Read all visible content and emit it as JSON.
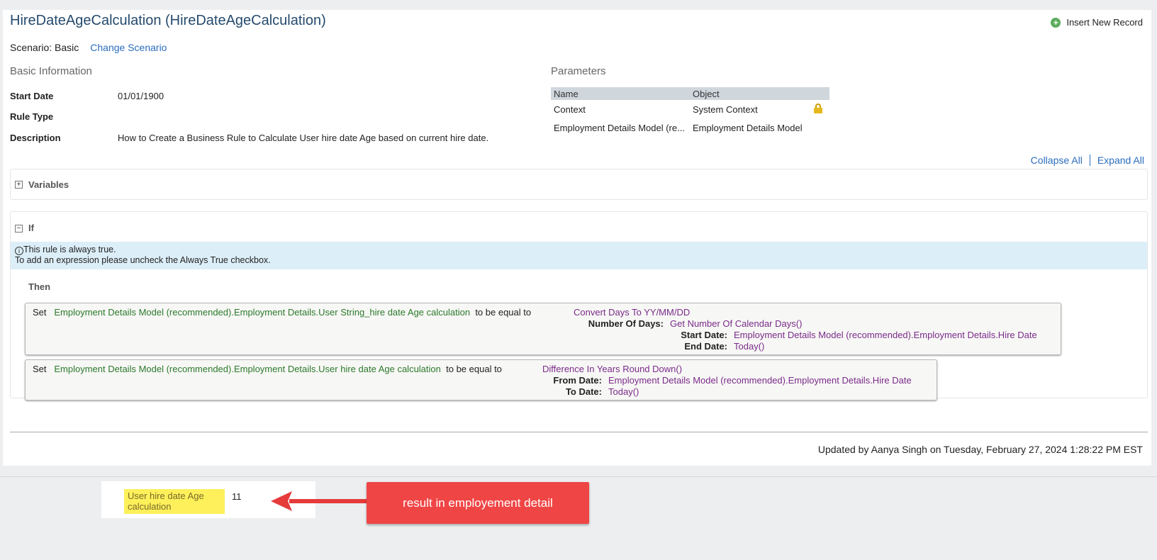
{
  "header": {
    "title": "HireDateAgeCalculation (HireDateAgeCalculation)",
    "insert_label": "Insert New Record"
  },
  "scenario": {
    "label": "Scenario: Basic",
    "change_label": "Change Scenario"
  },
  "basic_info": {
    "heading": "Basic Information",
    "rows": [
      {
        "label": "Start Date",
        "value": "01/01/1900"
      },
      {
        "label": "Rule Type",
        "value": ""
      },
      {
        "label": "Description",
        "value": "How to Create a Business Rule to Calculate User hire date Age based on current hire date."
      }
    ]
  },
  "parameters": {
    "heading": "Parameters",
    "columns": [
      "Name",
      "Object"
    ],
    "rows": [
      {
        "name": "Context",
        "object": "System Context",
        "locked": true
      },
      {
        "name": "Employment Details Model (re...",
        "object": "Employment Details Model",
        "locked": false
      }
    ]
  },
  "controls": {
    "collapse_all": "Collapse All",
    "expand_all": "Expand All"
  },
  "variables": {
    "label": "Variables",
    "toggle": "+"
  },
  "if_section": {
    "label": "If",
    "toggle": "−",
    "info_line1": "This rule is always true.",
    "info_line2": "To add an expression please uncheck the Always True checkbox.",
    "then_label": "Then"
  },
  "statements": [
    {
      "set": "Set",
      "target": "Employment Details Model (recommended).Employment Details.User String_hire date Age calculation",
      "op": "to be equal to",
      "func": "Convert Days To YY/MM/DD",
      "params": [
        {
          "label": "Number Of Days:",
          "value": "Get Number Of Calendar Days()"
        },
        {
          "label": "Start Date:",
          "value": "Employment Details Model (recommended).Employment Details.Hire Date"
        },
        {
          "label": "End Date:",
          "value": "Today()"
        }
      ]
    },
    {
      "set": "Set",
      "target": "Employment Details Model (recommended).Employment Details.User hire date Age calculation",
      "op": "to be equal to",
      "func": "Difference In Years Round Down()",
      "params": [
        {
          "label": "From Date:",
          "value": "Employment Details Model (recommended).Employment Details.Hire Date"
        },
        {
          "label": "To Date:",
          "value": "Today()"
        }
      ]
    }
  ],
  "footer": {
    "updated": "Updated by Aanya Singh on Tuesday, February 27, 2024 1:28:22 PM EST"
  },
  "result": {
    "label": "User hire date Age calculation",
    "value": "11",
    "callout": "result in employement detail"
  },
  "colors": {
    "title": "#254a6e",
    "link": "#2b6dbf",
    "field_green": "#2c7a2c",
    "func_purple": "#7a2b8a",
    "info_bg": "#dceef8",
    "highlight": "#fdf05a",
    "callout": "#f04545"
  }
}
